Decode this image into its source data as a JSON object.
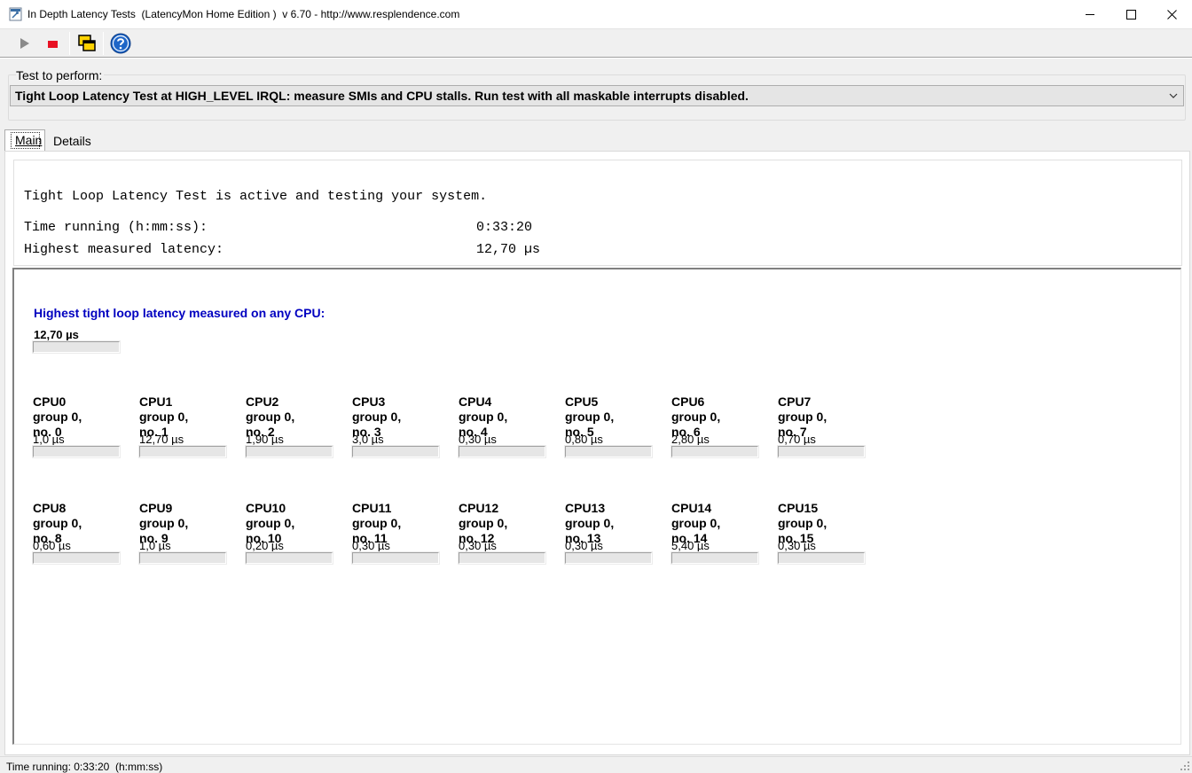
{
  "window": {
    "title": "In Depth Latency Tests  (LatencyMon Home Edition )  v 6.70 - http://www.resplendence.com"
  },
  "toolbar": {
    "buttons": [
      "play-icon",
      "stop-icon",
      "windows-icon",
      "help-icon"
    ],
    "stop_color": "#e81123",
    "help_color": "#1e66c8"
  },
  "test_select": {
    "label": "Test to perform:",
    "value": "Tight Loop Latency Test at HIGH_LEVEL IRQL:  measure SMIs and CPU stalls. Run test with all maskable interrupts disabled."
  },
  "tabs": [
    {
      "label": "Main",
      "active": true
    },
    {
      "label": "Details",
      "active": false
    }
  ],
  "info": {
    "status_line": "Tight Loop Latency Test is active and testing your system.",
    "time_label": "Time running (h:mm:ss):",
    "time_value": "0:33:20",
    "latency_label": "Highest measured latency:",
    "latency_value": "12,70 µs"
  },
  "highest": {
    "title": "Highest tight loop latency measured on any CPU:",
    "value": "12,70 µs",
    "level": 0
  },
  "cpus": [
    {
      "name": "CPU0",
      "group": "group 0,",
      "no": "no. 0",
      "value": "1,0 µs",
      "level": 0
    },
    {
      "name": "CPU1",
      "group": "group 0,",
      "no": "no. 1",
      "value": "12,70 µs",
      "level": 0
    },
    {
      "name": "CPU2",
      "group": "group 0,",
      "no": "no. 2",
      "value": "1,90 µs",
      "level": 0
    },
    {
      "name": "CPU3",
      "group": "group 0,",
      "no": "no. 3",
      "value": "3,0 µs",
      "level": 0
    },
    {
      "name": "CPU4",
      "group": "group 0,",
      "no": "no. 4",
      "value": "0,30 µs",
      "level": 0
    },
    {
      "name": "CPU5",
      "group": "group 0,",
      "no": "no. 5",
      "value": "0,80 µs",
      "level": 0
    },
    {
      "name": "CPU6",
      "group": "group 0,",
      "no": "no. 6",
      "value": "2,80 µs",
      "level": 0
    },
    {
      "name": "CPU7",
      "group": "group 0,",
      "no": "no. 7",
      "value": "0,70 µs",
      "level": 0
    },
    {
      "name": "CPU8",
      "group": "group 0,",
      "no": "no. 8",
      "value": "0,60 µs",
      "level": 0
    },
    {
      "name": "CPU9",
      "group": "group 0,",
      "no": "no. 9",
      "value": "1,0 µs",
      "level": 0
    },
    {
      "name": "CPU10",
      "group": "group 0,",
      "no": "no. 10",
      "value": "0,20 µs",
      "level": 0
    },
    {
      "name": "CPU11",
      "group": "group 0,",
      "no": "no. 11",
      "value": "0,30 µs",
      "level": 0
    },
    {
      "name": "CPU12",
      "group": "group 0,",
      "no": "no. 12",
      "value": "0,30 µs",
      "level": 0
    },
    {
      "name": "CPU13",
      "group": "group 0,",
      "no": "no. 13",
      "value": "0,30 µs",
      "level": 0
    },
    {
      "name": "CPU14",
      "group": "group 0,",
      "no": "no. 14",
      "value": "5,40 µs",
      "level": 0
    },
    {
      "name": "CPU15",
      "group": "group 0,",
      "no": "no. 15",
      "value": "0,30 µs",
      "level": 0
    }
  ],
  "statusbar": {
    "text": "Time running: 0:33:20  (h:mm:ss)"
  }
}
